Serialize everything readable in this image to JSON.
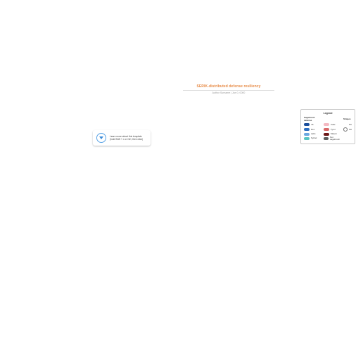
{
  "title": {
    "main": "SERIK-distributed defense resiliency",
    "sub": "Author Surname  |  Jan 0, 0000"
  },
  "tip": {
    "line1": "Learn more about this template",
    "line2_pre": "(hold Shift + ",
    "line2_key": "⌘",
    "line2_post": " or Ctrl, then click)"
  },
  "legend": {
    "title": "Legend",
    "col1_head": "Sagebrush defense",
    "col2_head": "",
    "col3_head": "Shapes",
    "rows": [
      {
        "c1_label": "JS",
        "c1_sw": "sw-js",
        "c2_label": "Vults",
        "c2_sw": "sw-vults",
        "shape": "hex",
        "shape_label": "PC"
      },
      {
        "c1_label": "Dev",
        "c1_sw": "sw-dev",
        "c2_label": "Tyrol",
        "c2_sw": "sw-tyrol",
        "shape": "circle",
        "shape_label": "SA"
      },
      {
        "c1_label": "Labs",
        "c1_sw": "sw-labs",
        "c2_label": "Mason",
        "c2_sw": "sw-mason"
      },
      {
        "c1_label": "Syntel",
        "c1_sw": "sw-syn",
        "c2_label": "Not sagebrush",
        "c2_sw": "sw-unex"
      }
    ]
  }
}
